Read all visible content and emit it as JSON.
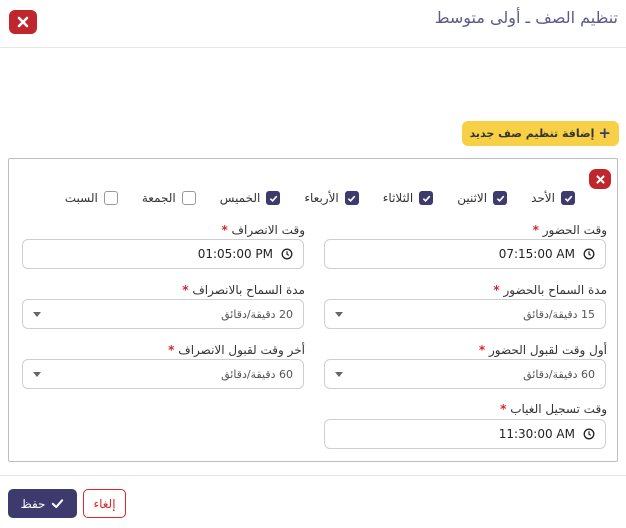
{
  "modal": {
    "title": "تنظيم الصف ـ أولى متوسط"
  },
  "toolbar": {
    "add_label": "إضافة تنظيم صف جديد"
  },
  "days": [
    {
      "label": "الأحد",
      "checked": true
    },
    {
      "label": "الاثنين",
      "checked": true
    },
    {
      "label": "الثلاثاء",
      "checked": true
    },
    {
      "label": "الأربعاء",
      "checked": true
    },
    {
      "label": "الخميس",
      "checked": true
    },
    {
      "label": "الجمعة",
      "checked": false
    },
    {
      "label": "السبت",
      "checked": false
    }
  ],
  "fields": {
    "attendance_time": {
      "label": "وقت الحضور",
      "value": "07:15:00 AM"
    },
    "departure_time": {
      "label": "وقت الانصراف",
      "value": "01:05:00 PM"
    },
    "attendance_grace": {
      "label": "مدة السماح بالحضور",
      "value": "15 دقيقة/دقائق"
    },
    "departure_grace": {
      "label": "مدة السماح بالانصراف",
      "value": "20 دقيقة/دقائق"
    },
    "first_attendance": {
      "label": "أول وقت لقبول الحضور",
      "value": "60 دقيقة/دقائق"
    },
    "last_departure": {
      "label": "أخر وقت لقبول الانصراف",
      "value": "60 دقيقة/دقائق"
    },
    "absence_time": {
      "label": "وقت تسجيل الغياب",
      "value": "11:30:00 AM"
    }
  },
  "footer": {
    "save_label": "حفظ",
    "cancel_label": "إلغاء"
  },
  "colors": {
    "primary": "#3d3b6e",
    "danger": "#c0272d",
    "warning": "#f7d046"
  }
}
